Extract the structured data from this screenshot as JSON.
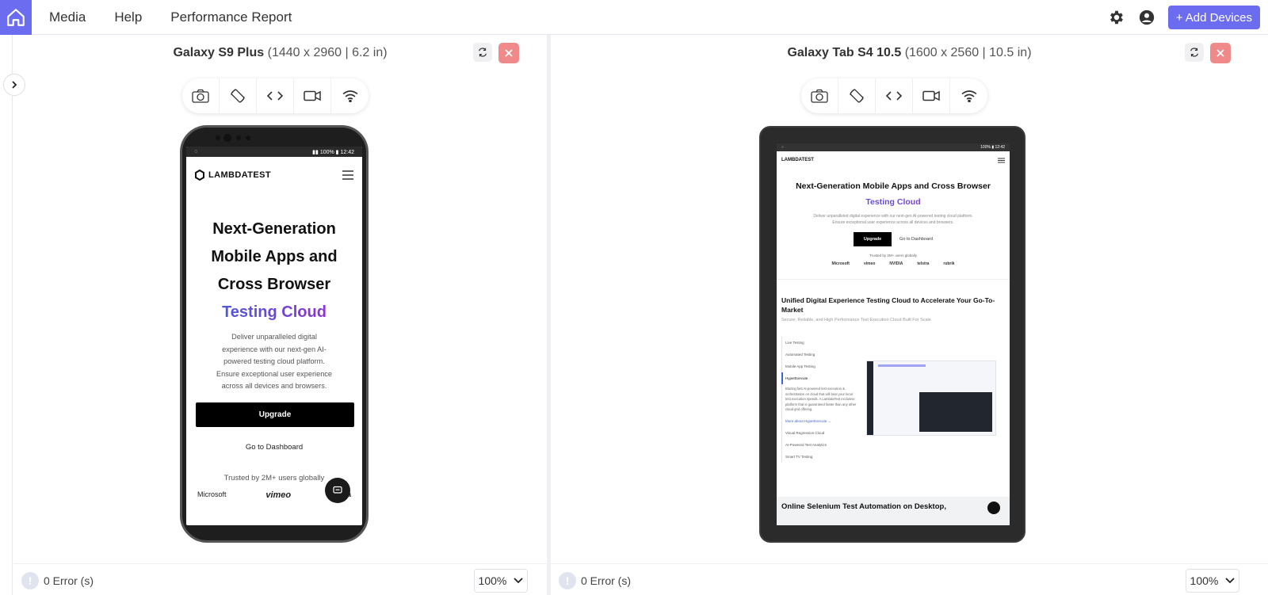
{
  "nav": {
    "items": [
      "Media",
      "Help",
      "Performance Report"
    ],
    "add_devices_label": "+ Add Devices"
  },
  "devices": [
    {
      "name": "Galaxy S9 Plus",
      "spec": "(1440 x 2960 | 6.2 in)",
      "errors_label": "0 Error (s)",
      "zoom": "100%",
      "screen": {
        "status_time": "12:42",
        "status_battery": "100%",
        "logo_text": "LAMBDATEST",
        "headline_lines": [
          "Next-Generation",
          "Mobile Apps and",
          "Cross Browser"
        ],
        "headline_gradient": "Testing Cloud",
        "description_lines": [
          "Deliver unparalleled digital",
          "experience with our next-gen AI-",
          "powered testing cloud platform.",
          "Ensure exceptional user experience",
          "across all devices and browsers."
        ],
        "upgrade_label": "Upgrade",
        "dashboard_label": "Go to Dashboard",
        "trusted_label": "Trusted by 2M+ users globally",
        "logos": [
          "Microsoft",
          "vimeo",
          "nvidia"
        ]
      }
    },
    {
      "name": "Galaxy Tab S4 10.5",
      "spec": "(1600 x 2560 | 10.5 in)",
      "errors_label": "0 Error (s)",
      "zoom": "100%",
      "screen": {
        "status_time": "12:42",
        "status_battery": "100%",
        "logo_text": "LAMBDATEST",
        "headline": "Next-Generation Mobile Apps and Cross Browser",
        "headline_gradient": "Testing Cloud",
        "description_lines": [
          "Deliver unparalleled digital experience with our next-gen AI-powered testing cloud platform.",
          "Ensure exceptional user experience across all devices and browsers."
        ],
        "upgrade_label": "Upgrade",
        "dashboard_label": "Go to Dashboard",
        "trusted_label": "Trusted by 2M+ users globally",
        "logos": [
          "Microsoft",
          "vimeo",
          "NVIDIA",
          "telstra",
          "rubrik"
        ],
        "section_title": "Unified Digital Experience Testing Cloud to Accelerate Your Go-To-Market",
        "section_sub": "Secure, Reliable, and High Performance Test Execution Cloud Built For Scale",
        "features": [
          "Live Testing",
          "Automated Testing",
          "Mobile App Testing",
          "HyperExecute"
        ],
        "features_after": [
          "Visual Regression Cloud",
          "AI-Powered Test Analytics",
          "Smart TV Testing"
        ],
        "feature_blurb": "Blazing fast AI-powered test execution & orchestration on cloud that will beat your local test execution speeds. A LambdaTest exclusive platform that is guaranteed faster than any other cloud grid offering.",
        "feature_more": "More about HyperExecute →",
        "bottom_title": "Online Selenium Test Automation on Desktop,"
      }
    }
  ]
}
